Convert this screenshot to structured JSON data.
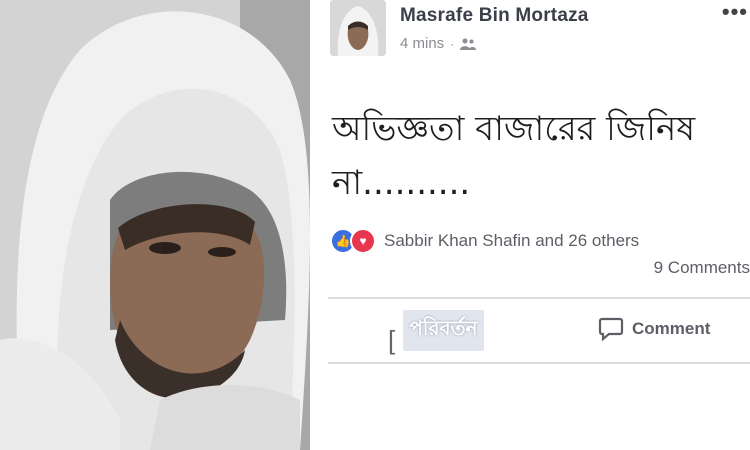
{
  "photo": {
    "alt": "",
    "colors": {
      "hood": "#f2f2f2",
      "shadow": "#9c9c9c",
      "skin": "#8a6a55"
    }
  },
  "post": {
    "author": "Masrafe Bin Mortaza",
    "time": "4 mins",
    "time_separator": "·",
    "privacy_icon": "friends-icon",
    "more_icon": "•••",
    "text_line1": "অভিজ্ঞতা বাজারের জিনিষ",
    "text_line2": "না..........",
    "reactions": {
      "like_icon": "👍",
      "love_icon": "♥",
      "names": "Sabbir Khan Shafin and 26 others"
    },
    "comments_count": "9 Comments",
    "actions": {
      "like_bracket": "[",
      "watermark_text": "পরিবর্তন",
      "comment_label": "Comment"
    }
  },
  "colors": {
    "author": "#3b3f48",
    "meta": "#8a8d91",
    "like": "#3b6ee0",
    "love": "#e8364e"
  }
}
